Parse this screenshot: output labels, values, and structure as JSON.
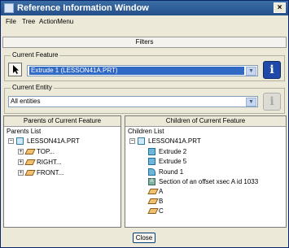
{
  "window": {
    "title": "Reference Information Window",
    "close_glyph": "×"
  },
  "menu": [
    "File",
    "Tree",
    "ActionMenu"
  ],
  "filters_label": "Filters",
  "current_feature": {
    "group_label": "Current Feature",
    "selected": "Extrude 1 (LESSON41A.PRT)",
    "dropdown_glyph": "▼",
    "info_glyph": "i"
  },
  "current_entity": {
    "group_label": "Current Entity",
    "selected": "All entities",
    "dropdown_glyph": "▼",
    "info_glyph": "i"
  },
  "parents_panel": {
    "header": "Parents of Current Feature",
    "list_label": "Parents List",
    "items": [
      {
        "label": "LESSON41A.PRT",
        "icon": "part-icon",
        "expander": "−"
      },
      {
        "label": "TOP...",
        "icon": "datum-plane-icon",
        "expander": "+"
      },
      {
        "label": "RIGHT...",
        "icon": "datum-plane-icon",
        "expander": "+"
      },
      {
        "label": "FRONT...",
        "icon": "datum-plane-icon",
        "expander": "+"
      }
    ]
  },
  "children_panel": {
    "header": "Children of Current Feature",
    "list_label": "Children List",
    "items": [
      {
        "label": "LESSON41A.PRT",
        "icon": "part-icon",
        "expander": "−"
      },
      {
        "label": "Extrude 2",
        "icon": "extrude-icon"
      },
      {
        "label": "Extrude 5",
        "icon": "extrude-icon"
      },
      {
        "label": "Round 1",
        "icon": "round-icon"
      },
      {
        "label": "Section of an offset xsec A id 1033",
        "icon": "section-icon",
        "glyph": "A"
      },
      {
        "label": "A",
        "icon": "datum-plane-icon"
      },
      {
        "label": "B",
        "icon": "datum-plane-icon"
      },
      {
        "label": "C",
        "icon": "datum-plane-icon"
      }
    ]
  },
  "close_button": "Close",
  "colors": {
    "title_bar": "#244f8a",
    "selection": "#316ac5",
    "info_button": "#1f4aa8"
  }
}
